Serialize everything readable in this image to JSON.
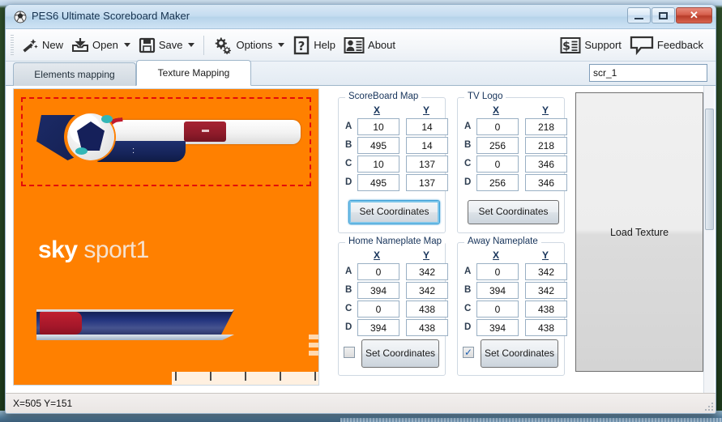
{
  "window": {
    "title": "PES6 Ultimate Scoreboard Maker",
    "icon": "soccer-ball-icon",
    "controls": {
      "minimize": "—",
      "maximize": "□",
      "close": "✕"
    }
  },
  "toolbar": {
    "items": [
      {
        "label": "New",
        "icon": "magic-wand-icon",
        "dropdown": false
      },
      {
        "label": "Open",
        "icon": "open-folder-icon",
        "dropdown": true
      },
      {
        "label": "Save",
        "icon": "floppy-disk-icon",
        "dropdown": true
      },
      {
        "label": "Options",
        "icon": "gears-icon",
        "dropdown": true
      },
      {
        "label": "Help",
        "icon": "question-mark-icon",
        "dropdown": false
      },
      {
        "label": "About",
        "icon": "person-card-icon",
        "dropdown": false
      }
    ],
    "right_items": [
      {
        "label": "Support",
        "icon": "dollar-list-icon"
      },
      {
        "label": "Feedback",
        "icon": "speech-bubble-icon"
      }
    ]
  },
  "tabs": {
    "items": [
      {
        "label": "Elements mapping",
        "active": false
      },
      {
        "label": "Texture Mapping",
        "active": true
      }
    ]
  },
  "name_field": {
    "value": "scr_1",
    "placeholder": ""
  },
  "texture": {
    "background_color": "#ff8000",
    "logo_bold": "sky",
    "logo_light": " sport1",
    "selection_color": "#e30b0b"
  },
  "groups": [
    {
      "key": "scoreboard",
      "title": "ScoreBoard Map",
      "headers": {
        "x": "X",
        "y": "Y"
      },
      "rows": [
        {
          "label": "A",
          "x": "10",
          "y": "14"
        },
        {
          "label": "B",
          "x": "495",
          "y": "14"
        },
        {
          "label": "C",
          "x": "10",
          "y": "137"
        },
        {
          "label": "D",
          "x": "495",
          "y": "137"
        }
      ],
      "button": "Set Coordinates",
      "focused": true,
      "checkbox": null
    },
    {
      "key": "tvlogo",
      "title": "TV Logo",
      "headers": {
        "x": "X",
        "y": "Y"
      },
      "rows": [
        {
          "label": "A",
          "x": "0",
          "y": "218"
        },
        {
          "label": "B",
          "x": "256",
          "y": "218"
        },
        {
          "label": "C",
          "x": "0",
          "y": "346"
        },
        {
          "label": "D",
          "x": "256",
          "y": "346"
        }
      ],
      "button": "Set Coordinates",
      "focused": false,
      "checkbox": null
    },
    {
      "key": "home_nameplate",
      "title": "Home Nameplate Map",
      "headers": {
        "x": "X",
        "y": "Y"
      },
      "rows": [
        {
          "label": "A",
          "x": "0",
          "y": "342"
        },
        {
          "label": "B",
          "x": "394",
          "y": "342"
        },
        {
          "label": "C",
          "x": "0",
          "y": "438"
        },
        {
          "label": "D",
          "x": "394",
          "y": "438"
        }
      ],
      "button": "Set Coordinates",
      "focused": false,
      "checkbox": {
        "checked": false,
        "mark": "✓"
      }
    },
    {
      "key": "away_nameplate",
      "title": "Away Nameplate",
      "headers": {
        "x": "X",
        "y": "Y"
      },
      "rows": [
        {
          "label": "A",
          "x": "0",
          "y": "342"
        },
        {
          "label": "B",
          "x": "394",
          "y": "342"
        },
        {
          "label": "C",
          "x": "0",
          "y": "438"
        },
        {
          "label": "D",
          "x": "394",
          "y": "438"
        }
      ],
      "button": "Set Coordinates",
      "focused": false,
      "checkbox": {
        "checked": true,
        "mark": "✓"
      }
    }
  ],
  "load_texture": {
    "label": "Load Texture"
  },
  "statusbar": {
    "text": "X=505  Y=151"
  }
}
